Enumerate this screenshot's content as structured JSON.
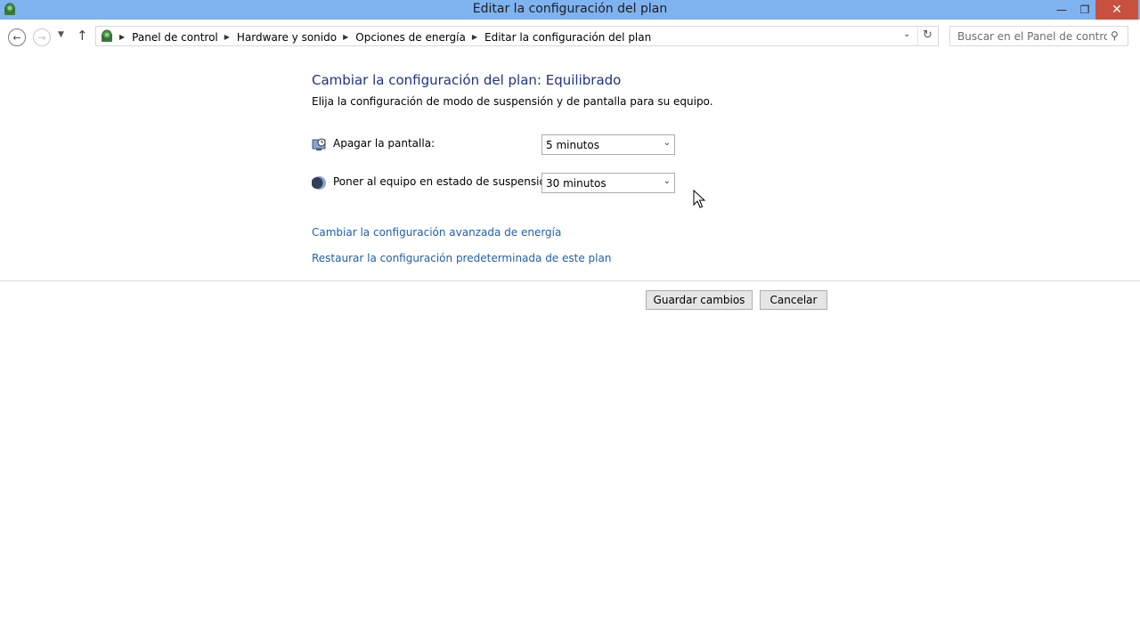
{
  "window": {
    "title": "Editar la configuración del plan",
    "minimize_icon": "minimize-icon",
    "maximize_icon": "restore-icon",
    "close_icon": "close-icon"
  },
  "navigation": {
    "breadcrumbs": [
      "Panel de control",
      "Hardware y sonido",
      "Opciones de energía",
      "Editar la configuración del plan"
    ],
    "search_placeholder": "Buscar en el Panel de control"
  },
  "main": {
    "heading": "Cambiar la configuración del plan: Equilibrado",
    "subtitle": "Elija la configuración de modo de suspensión y de pantalla para su equipo.",
    "settings": [
      {
        "label": "Apagar la pantalla:",
        "value": "5 minutos",
        "icon": "monitor-clock-icon"
      },
      {
        "label": "Poner al equipo en estado de suspensión:",
        "value": "30 minutos",
        "icon": "moon-icon"
      }
    ],
    "links": {
      "advanced": "Cambiar la configuración avanzada de energía",
      "restore": "Restaurar la configuración predeterminada de este plan"
    }
  },
  "buttons": {
    "save": "Guardar cambios",
    "cancel": "Cancelar"
  },
  "colors": {
    "titlebar": "#7fb3f0",
    "heading": "#1e3287",
    "link": "#1f5fad",
    "close_button": "#c7503f"
  }
}
